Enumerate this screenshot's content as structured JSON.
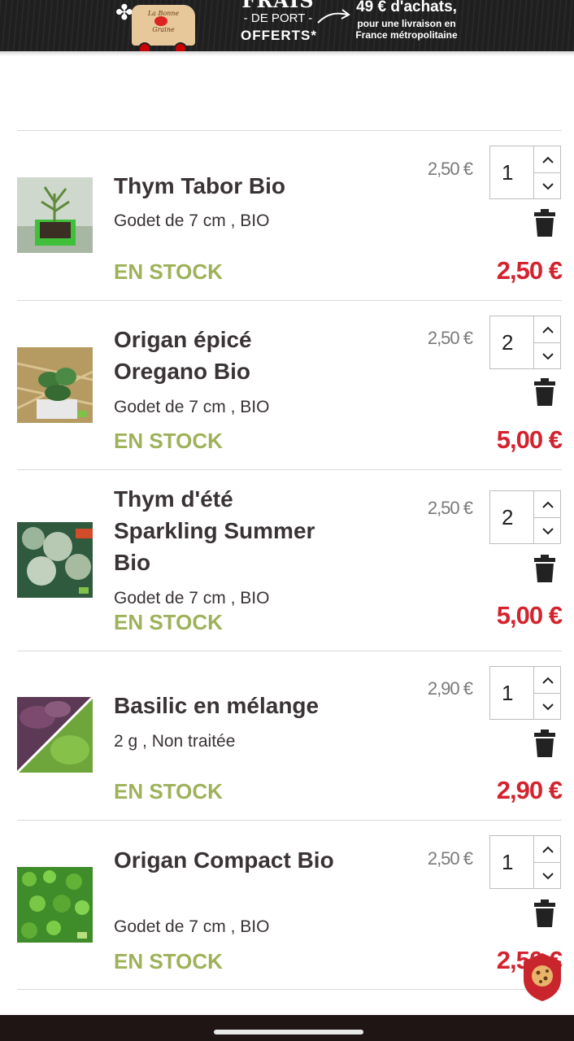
{
  "banner": {
    "frais": "FRAIS",
    "de_port": "- DE PORT -",
    "offerts": "OFFERTS*",
    "amount": "49 € d'achats,",
    "fine_line1": "pour une livraison en",
    "fine_line2": "France métropolitaine",
    "logo_line1": "La Bonne",
    "logo_line2": "Graine"
  },
  "cart": {
    "items": [
      {
        "name": "Thym Tabor Bio",
        "variant": "Godet de 7 cm , BIO",
        "stock": "EN STOCK",
        "unit_price": "2,50 €",
        "quantity": "1",
        "total": "2,50 €"
      },
      {
        "name": "Origan épicé Oregano Bio",
        "variant": "Godet de 7 cm , BIO",
        "stock": "EN STOCK",
        "unit_price": "2,50 €",
        "quantity": "2",
        "total": "5,00 €"
      },
      {
        "name": "Thym d'été Sparkling Summer Bio",
        "variant": "Godet de 7 cm , BIO",
        "stock": "EN STOCK",
        "unit_price": "2,50 €",
        "quantity": "2",
        "total": "5,00 €"
      },
      {
        "name": "Basilic en mélange",
        "variant": "2 g , Non traitée",
        "stock": "EN STOCK",
        "unit_price": "2,90 €",
        "quantity": "1",
        "total": "2,90 €"
      },
      {
        "name": "Origan Compact Bio",
        "variant": "Godet de 7 cm , BIO",
        "stock": "EN STOCK",
        "unit_price": "2,50 €",
        "quantity": "1",
        "total": "2,50 €"
      }
    ]
  },
  "icons": {
    "trash": "trash-icon",
    "up": "chevron-up-icon",
    "down": "chevron-down-icon",
    "cookie": "cookie-icon"
  },
  "colors": {
    "stock_green": "#9db25a",
    "total_red": "#d3232e",
    "text_dark": "#3a3335",
    "banner_bg": "#1f1f1f"
  }
}
